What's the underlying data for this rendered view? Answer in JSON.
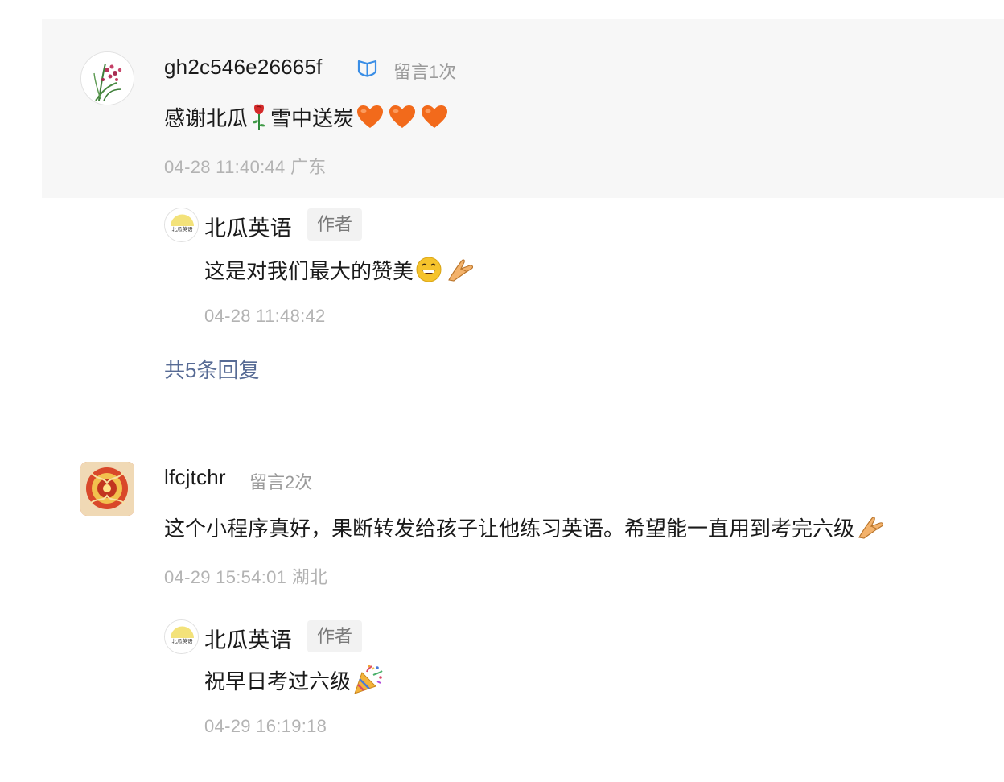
{
  "comments": [
    {
      "author": "gh2c546e26665f",
      "count_label": "留言1次",
      "content_parts": [
        "感谢北瓜",
        "雪中送炭"
      ],
      "emoji": [
        "rose-icon",
        "orange-heart-icon",
        "orange-heart-icon",
        "orange-heart-icon"
      ],
      "meta": "04-28 11:40:44 广东",
      "reply": {
        "author": "北瓜英语",
        "badge": "作者",
        "content": "这是对我们最大的赞美",
        "emoji": [
          "grinning-face-icon",
          "pinching-hand-icon"
        ],
        "meta": "04-28 11:48:42"
      },
      "more_replies": "共5条回复"
    },
    {
      "author": "lfcjtchr",
      "count_label": "留言2次",
      "content": "这个小程序真好，果断转发给孩子让他练习英语。希望能一直用到考完六级",
      "emoji": [
        "pinching-hand-icon"
      ],
      "meta": "04-29 15:54:01 湖北",
      "reply": {
        "author": "北瓜英语",
        "badge": "作者",
        "content": "祝早日考过六级",
        "emoji": [
          "party-popper-icon"
        ],
        "meta": "04-29 16:19:18"
      }
    }
  ],
  "avatar_logo_text": "北瓜英语",
  "colors": {
    "highlight_bg": "#f7f7f7",
    "link": "#576b95",
    "meta": "#b3b3b3",
    "count": "#9a9a9a",
    "verified": "#3a8ee6",
    "heart": "#f26a1b"
  }
}
